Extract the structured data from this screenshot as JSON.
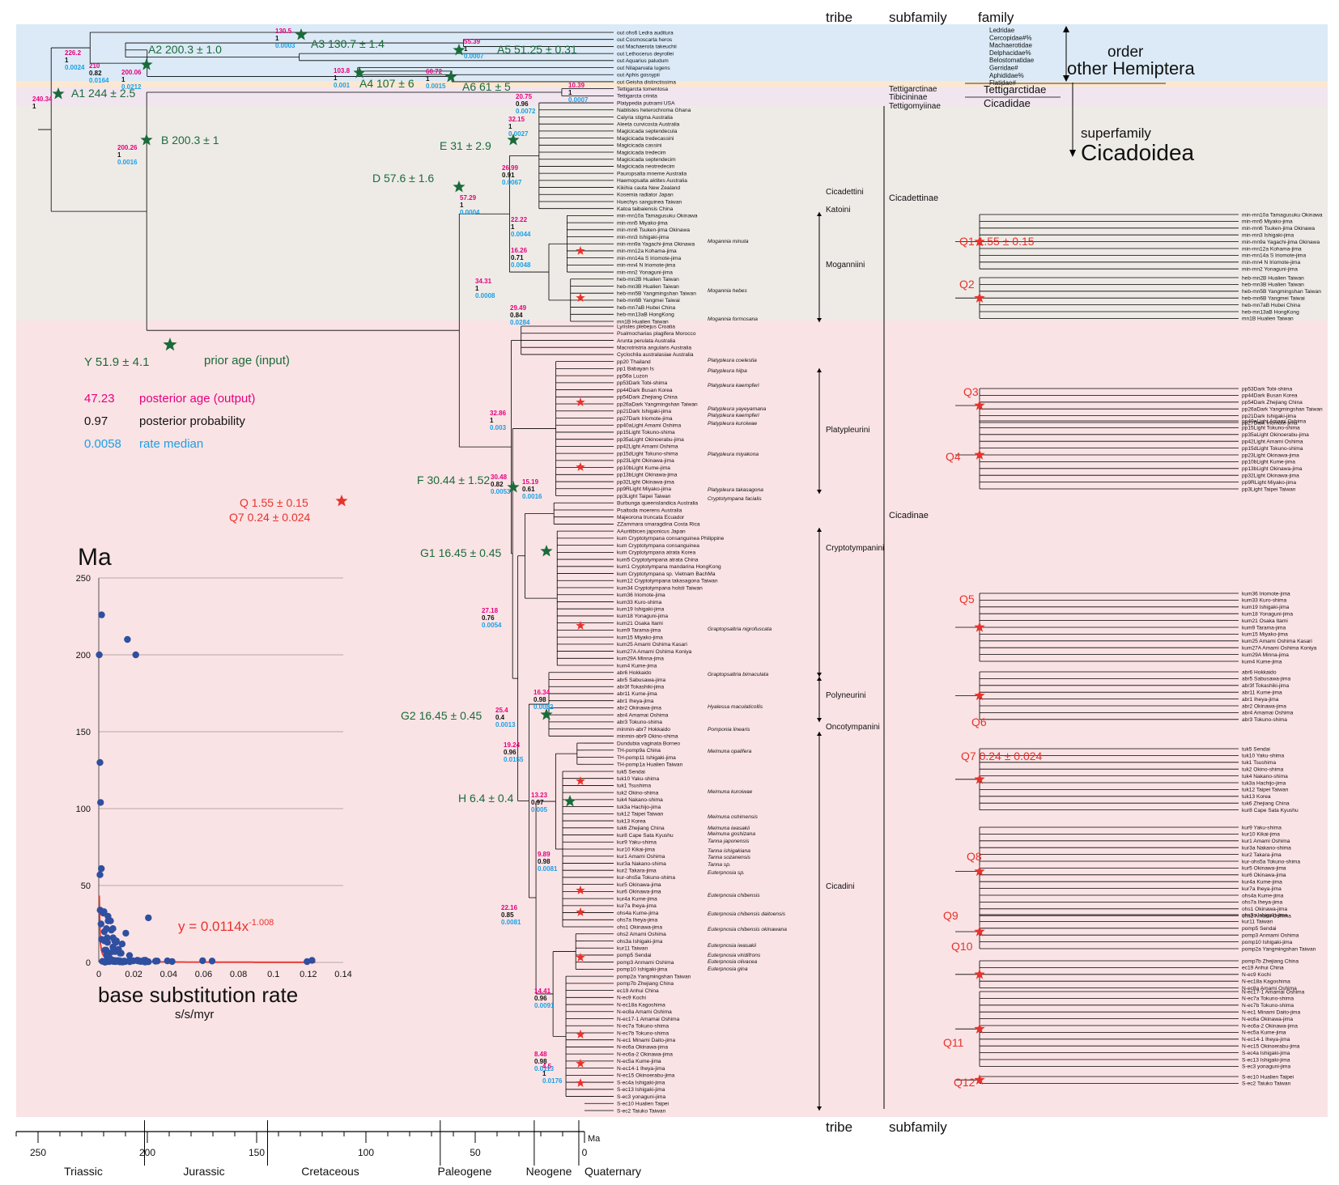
{
  "header": {
    "tribe": "tribe",
    "subfamily": "subfamily",
    "family": "family",
    "order": "order",
    "other_hemiptera": "other Hemiptera",
    "superfamily": "superfamily",
    "cicadoidea": "Cicadoidea"
  },
  "footer": {
    "tribe": "tribe",
    "subfamily": "subfamily"
  },
  "families": [
    "Ledridae",
    "Cercopidae#%",
    "Machaerotidae",
    "Delphacidae%",
    "Belostomatidae",
    "Gerridae#",
    "Aphididae%",
    "Flatidae#"
  ],
  "subfamilies": [
    "Tettigarctinae",
    "Tibicininae",
    "Tettigomyiinae",
    "Cicadettinae",
    "Cicadinae"
  ],
  "families_cicada": [
    "Tettigarctidae",
    "Cicadidae"
  ],
  "tribes": [
    "Cicadettini",
    "Katoini",
    "Moganniini",
    "Platypleurini",
    "Cryptotympanini",
    "Polyneurini",
    "Oncotympanini",
    "Cicadini"
  ],
  "legend": {
    "y_label": "Y  51.9 ± 4.1",
    "prior": "prior age (input)",
    "posterior_value": "47.23",
    "posterior": "posterior age (output)",
    "prob_value": "0.97",
    "prob": "posterior probability",
    "rate_value": "0.0058",
    "rate": "rate median",
    "q_line1": "Q  1.55 ± 0.15",
    "q_line2": "Q7  0.24 ± 0.024"
  },
  "calibrations": [
    {
      "id": "A1",
      "label": "A1  244 ± 2.5"
    },
    {
      "id": "A2",
      "label": "A2  200.3 ± 1.0"
    },
    {
      "id": "A3",
      "label": "A3  130.7 ± 1.4"
    },
    {
      "id": "A4",
      "label": "A4  107 ± 6"
    },
    {
      "id": "A5",
      "label": "A5  51.25 ± 0.31"
    },
    {
      "id": "A6",
      "label": "A6  61 ± 5"
    },
    {
      "id": "B",
      "label": "B  200.3 ± 1"
    },
    {
      "id": "D",
      "label": "D  57.6 ± 1.6"
    },
    {
      "id": "E",
      "label": "E  31 ± 2.9"
    },
    {
      "id": "F",
      "label": "F  30.44 ± 1.52"
    },
    {
      "id": "G1",
      "label": "G1  16.45 ± 0.45"
    },
    {
      "id": "G2",
      "label": "G2  16.45 ± 0.45"
    },
    {
      "id": "H",
      "label": "H  6.4 ± 0.4"
    }
  ],
  "q_calibrations": [
    "Q1  1.55 ± 0.15",
    "Q2",
    "Q3",
    "Q4",
    "Q5",
    "Q6",
    "Q7  0.24 ± 0.024",
    "Q8",
    "Q9",
    "Q10",
    "Q11",
    "Q12"
  ],
  "node_annotations": [
    {
      "a": "240.34",
      "p": "1",
      "r": ""
    },
    {
      "a": "226.2",
      "p": "1",
      "r": "0.0024"
    },
    {
      "a": "210",
      "p": "0.82",
      "r": "0.0164"
    },
    {
      "a": "200.06",
      "p": "1",
      "r": "0.0212"
    },
    {
      "a": "130.5",
      "p": "1",
      "r": "0.0003"
    },
    {
      "a": "55.39",
      "p": "1",
      "r": "0.0007"
    },
    {
      "a": "103.8",
      "p": "1",
      "r": "0.001"
    },
    {
      "a": "60.72",
      "p": "1",
      "r": "0.0015"
    },
    {
      "a": "10.39",
      "p": "1",
      "r": "0.0007"
    },
    {
      "a": "200.26",
      "p": "1",
      "r": "0.0016"
    },
    {
      "a": "57.29",
      "p": "1",
      "r": "0.0004"
    },
    {
      "a": "34.31",
      "p": "1",
      "r": "0.0008"
    },
    {
      "a": "29.49",
      "p": "0.84",
      "r": "0.0284"
    },
    {
      "a": "32.86",
      "p": "1",
      "r": "0.003"
    },
    {
      "a": "30.48",
      "p": "0.82",
      "r": "0.0053"
    },
    {
      "a": "25.4",
      "p": "0.4",
      "r": "0.0013"
    },
    {
      "a": "19.24",
      "p": "0.96",
      "r": "0.0155"
    },
    {
      "a": "22.16",
      "p": "0.85",
      "r": "0.0081"
    },
    {
      "a": "27.18",
      "p": "0.76",
      "r": "0.0054"
    },
    {
      "a": "14.41",
      "p": "0.96",
      "r": "0.0091"
    },
    {
      "a": "8.48",
      "p": "0.98",
      "r": "0.0113"
    },
    {
      "a": "4.5",
      "p": "1",
      "r": "0.0176"
    },
    {
      "a": "20.75",
      "p": "0.96",
      "r": "0.0072"
    },
    {
      "a": "32.15",
      "p": "1",
      "r": "0.0027"
    },
    {
      "a": "26.99",
      "p": "0.91",
      "r": "0.0067"
    },
    {
      "a": "22.22",
      "p": "1",
      "r": "0.0044"
    },
    {
      "a": "16.26",
      "p": "0.71",
      "r": "0.0048"
    },
    {
      "a": "15.19",
      "p": "0.61",
      "r": "0.0016"
    },
    {
      "a": "16.34",
      "p": "0.98",
      "r": "0.0082"
    },
    {
      "a": "9.89",
      "p": "0.98",
      "r": "0.0081"
    },
    {
      "a": "13.23",
      "p": "0.97",
      "r": "0.005"
    }
  ],
  "species_top": [
    "out ohs6 Ledra auditura",
    "out Cosmoscarta heros",
    "out Machaerota takeuchii",
    "out Lethocerus deyrollei",
    "out Aquarius paludum",
    "out Nilaparvata lugens",
    "out Aphis gossypii",
    "out Geisha distinctissima",
    "Tettigarcta tomentosa",
    "Tettigarcta crinita",
    "Platypedia putnami USA",
    "Nablistes heterochroma Ghana",
    "Calyria stigma Australia",
    "Aleeta curvicosta Australia",
    "Magicicada septendecula",
    "Magicicada tredecassini",
    "Magicicada cassini",
    "Magicicada tredecim",
    "Magicicada septendecim",
    "Magicicada neotredecim",
    "Pauropsalta mneme Australia",
    "Haemopsalta aktites Australia",
    "Kikihia cauta New Zealand",
    "Kosemia radiator Japan",
    "Huechys sanguinea Taiwan",
    "Katoa taibaiensis China",
    "min-mn10a Tamagusuku Okinawa",
    "min-mn5 Miyako-jima",
    "min-mn6 Tsuken-jima Okinawa",
    "min-mn3 Ishigaki-jima",
    "min-mn9a Yagachi-jima Okinawa",
    "min-mn12a Kohama-jima",
    "min-mn14a S Iriomote-jima",
    "min-mn4 N Iriomote-jima",
    "min-mn2 Yonaguni-jima",
    "heb-mn2B Hualien Taiwan",
    "heb-mn3B Hualien Taiwan",
    "heb-mn5B Yangmingshan Taiwan",
    "heb-mn6B Yangmei Taiwai",
    "heb-mn7aB Hubei China",
    "heb-mn13aB HongKong",
    "mn1B Hualien Taiwan"
  ],
  "species_bottom": [
    "Lyristes plebejus Croatia",
    "Psalmocharias plagifera Morocco",
    "Arunta perulata Australia",
    "Macrotristria angularis Australia",
    "Cyclochila australasiae Australia",
    "pp20 Thailand",
    "pp1 Babayan Is",
    "pp56a Luzon",
    "pp53Dark Tobi-shima",
    "pp44Dark Busan Korea",
    "pp54Dark Zhejiang China",
    "pp26aDark Yangmingshan Taiwan",
    "pp21Dark Ishigaki-jima",
    "pp27Dark Iriomote-jima",
    "pp40aLight Amami Oshima",
    "pp15Light Tokuno-shima",
    "pp35aLight Okinoerabu-jima",
    "pp42Light Amami Oshima",
    "pp15dLight Tokuno-shima",
    "pp23Light Okinawa-jima",
    "pp10bLight Kume-jima",
    "pp13bLight Okinawa-jima",
    "pp32Light Okinawa-jima",
    "pp9RLight Miyako-jima",
    "pp3Light Taipei Taiwan",
    "Burbunga queenslandica Australia",
    "Psaltoda moerens Australia",
    "Majeorona truncata Ecuador",
    "ZZammara smaragdina Costa Rica",
    "AAuritibicen japonicus Japan",
    "kum Cryptotympana consanguinea Philippine",
    "kum Cryptotympana consanguinea",
    "kum Cryptotympana atrata Korea",
    "kum5 Cryptotympana atrata China",
    "kum1 Cryptotympana mandarina HongKong",
    "kum Cryptotympana sp. Vietnam BachMa",
    "kum12 Cryptotympana takasagona Taiwan",
    "kum34 Cryptotympana holsti Taiwan",
    "kum36 Iriomote-jima",
    "kum33 Kuro-shima",
    "kum19 Ishigaki-jima",
    "kum18 Yonaguni-jima",
    "kum21 Osaka Itami",
    "kum9 Tarama-jima",
    "kum15 Miyako-jima",
    "kum25 Amami Oshima Kasari",
    "kum27A Amami Oshima Koniya",
    "kum29A Minna-jima",
    "kum4 Kume-jima",
    "abr6 Hokkaido",
    "abr5 Sabusawa-jima",
    "abr3f Tokashiki-jima",
    "abr11 Kume-jima",
    "abr1 Iheya-jima",
    "abr2 Okinawa-jima",
    "abr4 Amamai Oshima",
    "abr3 Tokuno-shima",
    "minmin-abr7 Hokkaido",
    "minmin-abr9 Okino-shima",
    "Dundubia vaginata Borneo",
    "TH-pomp9a China",
    "TH-pomp11 Ishigaki-jima",
    "TH-pomp1a Hualien Taiwan",
    "tuk5 Sendai",
    "tuk10 Yaku-shima",
    "tuk1 Tsushima",
    "tuk2 Okino-shima",
    "tuk4 Nakano-shima",
    "tuk3a Hachijo-jima",
    "tuk12 Taipei Taiwan",
    "tuk13 Korea",
    "tuk6 Zhejiang China",
    "kur8 Cape Sata Kyushu",
    "kur9 Yaku-shima",
    "kur10 Kikai-jima",
    "kur1 Amami Oshima",
    "kur3a Nakano-shima",
    "kur2 Takara-jima",
    "kur-ohs5a Tokuno-shima",
    "kur5 Okinawa-jima",
    "kur6 Okinawa-jima",
    "kur4a Kume-jima",
    "kur7a Iheya-jima",
    "ohs4a Kume-jima",
    "ohs7a Iheya-jima",
    "ohs1 Okinawa-jima",
    "ohs2 Amami Oshima",
    "ohs3a Ishigaki-jima",
    "kur11 Taiwan",
    "pomp5 Sendai",
    "pomp3 Anmami Oshima",
    "pomp10 Ishigaki-jima",
    "pomp2a Yangmingshan Taiwan",
    "pomp7b Zhejiang China",
    "ec19 Anhui China",
    "N-ec9 Kochi",
    "N-ec18a Kagoshima",
    "N-ec8a Amami Oshima",
    "N-ec17-1 Amamai Oshima",
    "N-ec7a Tokuno-shima",
    "N-ec7b Tokuno-shima",
    "N-ec1 Minami Daito-jima",
    "N-ec6a Okinawa-jima",
    "N-ec6a-2 Okinawa-jima",
    "N-ec5a Kume-jima",
    "N-ec14-1 Iheya-jima",
    "N-ec15 Okinoerabu-jima",
    "S-ec4a Ishigaki-jima",
    "S-ec13 Ishigaki-jima",
    "S-ec3 yonaguni-jima",
    "S-ec10 Hualien Taipei",
    "S-ec2 Taiuko Taiwan"
  ],
  "species_labels": [
    "Mogannia minuta",
    "Mogannia hebes",
    "Mogannia formosana",
    "Platypleura coelestia",
    "Platypleura hilpa",
    "Platypleura kaempferi",
    "Platypleura yayeyamana",
    "Platypleura kaempferi",
    "Platypleura kuroiwae",
    "Platypleura miyakona",
    "Platypleura takasagona",
    "Cryptotympana facialis",
    "Graptopsaltria nigrofuscata",
    "Graptopsaltria bimaculata",
    "Hyalessa maculaticollis",
    "Pomponia linearis",
    "Meimuna opalifera",
    "Meimuna kuroiwae",
    "Meimuna oshimensis",
    "Meimuna iwasakii",
    "Meimuna goshizana",
    "Tanna japonensis",
    "Tanna ishigakiana",
    "Tanna sozanensis",
    "Tanna sp.",
    "Euterpnosia sp.",
    "Euterpnosia chibensis",
    "Euterpnosia chibensis daitoensis",
    "Euterpnosia chibensis okinawana",
    "Euterpnosia iwasakii",
    "Euterpnosia viridifrons",
    "Euterpnosia olivacea",
    "Euterpnosia gina"
  ],
  "timescale": {
    "ticks": [
      "250",
      "200",
      "150",
      "100",
      "50",
      "0"
    ],
    "unit": "Ma",
    "periods": [
      "Triassic",
      "Jurassic",
      "Cretaceous",
      "Paleogene",
      "Neogene",
      "Quaternary"
    ]
  },
  "chart_data": {
    "type": "scatter",
    "ylabel": "Ma",
    "xlabel": "base substitution rate",
    "xunit": "s/s/myr",
    "xlim": [
      0,
      0.14
    ],
    "ylim": [
      0,
      250
    ],
    "xticks": [
      "0",
      "0.02",
      "0.04",
      "0.06",
      "0.08",
      "0.1",
      "0.12",
      "0.14"
    ],
    "yticks": [
      "250",
      "200",
      "150",
      "100",
      "50",
      "0"
    ],
    "grid": true,
    "fit_label": "y = 0.0114x",
    "fit_exponent": "-1.008",
    "fit": {
      "a": 0.0114,
      "b": -1.008
    },
    "points": [
      [
        0.0016,
        226
      ],
      [
        0.0003,
        200
      ],
      [
        0.0164,
        210
      ],
      [
        0.0212,
        200
      ],
      [
        0.0007,
        130
      ],
      [
        0.001,
        104
      ],
      [
        0.0015,
        61
      ],
      [
        0.0007,
        57
      ],
      [
        0.0008,
        34
      ],
      [
        0.0284,
        29
      ],
      [
        0.003,
        33
      ],
      [
        0.0053,
        30
      ],
      [
        0.0013,
        25
      ],
      [
        0.0155,
        19
      ],
      [
        0.0081,
        22
      ],
      [
        0.0054,
        27
      ],
      [
        0.0091,
        14
      ],
      [
        0.0113,
        8.5
      ],
      [
        0.0176,
        4.5
      ],
      [
        0.0072,
        21
      ],
      [
        0.0027,
        32
      ],
      [
        0.0067,
        27
      ],
      [
        0.0044,
        22
      ],
      [
        0.0048,
        16
      ],
      [
        0.0016,
        15
      ],
      [
        0.0082,
        16
      ],
      [
        0.0081,
        10
      ],
      [
        0.005,
        13
      ],
      [
        0.0032,
        20
      ],
      [
        0.0101,
        14
      ],
      [
        0.0035,
        8
      ],
      [
        0.0094,
        7
      ],
      [
        0.0079,
        7
      ],
      [
        0.0128,
        6
      ],
      [
        0.0047,
        4
      ],
      [
        0.0033,
        14
      ],
      [
        0.0098,
        13
      ],
      [
        0.0046,
        5
      ],
      [
        0.0054,
        6
      ],
      [
        0.0122,
        6
      ],
      [
        0.0042,
        8
      ],
      [
        0.0134,
        12
      ],
      [
        0.0061,
        1.2
      ],
      [
        0.0058,
        4
      ],
      [
        0.0053,
        3.4
      ],
      [
        0.0335,
        0.9
      ],
      [
        0.0097,
        0.5
      ],
      [
        0.0177,
        1.2
      ],
      [
        0.0056,
        0.8
      ],
      [
        0.0124,
        0.3
      ],
      [
        0.0224,
        1
      ],
      [
        0.0236,
        0.9
      ],
      [
        0.0393,
        1
      ],
      [
        0.0256,
        0.7
      ],
      [
        0.0281,
        0.5
      ],
      [
        0.0059,
        1.3
      ],
      [
        0.0221,
        1.4
      ],
      [
        0.0284,
        0.4
      ],
      [
        0.0091,
        0.9
      ],
      [
        0.0153,
        0.6
      ],
      [
        0.023,
        0.9
      ],
      [
        0.0111,
        1.2
      ],
      [
        0.0062,
        0.6
      ],
      [
        0.0085,
        0.6
      ],
      [
        0.0649,
        0.9
      ],
      [
        0.1221,
        1.3
      ],
      [
        0.0117,
        0.4
      ],
      [
        0.0265,
        0.2
      ],
      [
        0.042,
        0.6
      ],
      [
        0.0595,
        1.1
      ],
      [
        0.0328,
        0.9
      ],
      [
        0.1193,
        0.5
      ],
      [
        0.0198,
        1
      ],
      [
        0.0225,
        1.2
      ],
      [
        0.0267,
        1.4
      ],
      [
        0.0241,
        0.6
      ],
      [
        0.0145,
        0.9
      ],
      [
        0.0122,
        1
      ],
      [
        0.0137,
        0.2
      ],
      [
        0.0325,
        0.8
      ],
      [
        0.0258,
        1.3
      ],
      [
        0.0178,
        0.4
      ],
      [
        0.0095,
        1.2
      ],
      [
        0.0054,
        0.5
      ],
      [
        0.0078,
        1.6
      ],
      [
        0.0044,
        0.5
      ],
      [
        0.0021,
        0.7
      ],
      [
        0.0036,
        0.1
      ]
    ]
  }
}
